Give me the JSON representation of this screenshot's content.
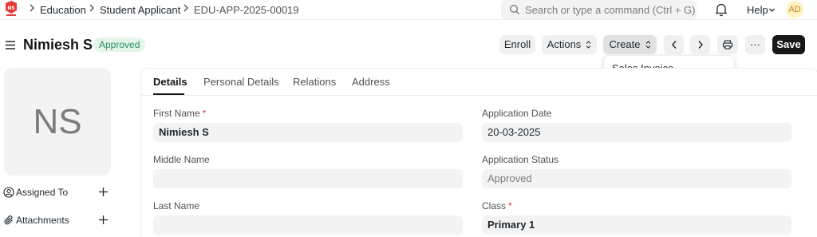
{
  "navbar": {
    "logo_name": "school-logo",
    "breadcrumbs": [
      "Education",
      "Student Applicant",
      "EDU-APP-2025-00019"
    ],
    "search_placeholder": "Search or type a command (Ctrl + G)",
    "help_label": "Help",
    "user_initials": "AD"
  },
  "header": {
    "title": "Nimiesh S",
    "status": "Approved",
    "buttons": {
      "enroll": "Enroll",
      "actions": "Actions",
      "create": "Create",
      "more": "···",
      "save": "Save"
    },
    "create_menu": [
      "Sales Invoice"
    ]
  },
  "sidebar": {
    "avatar_initials": "NS",
    "items": [
      {
        "label": "Assigned To",
        "icon": "user-circle-icon"
      },
      {
        "label": "Attachments",
        "icon": "paperclip-icon"
      }
    ]
  },
  "tabs": [
    "Details",
    "Personal Details",
    "Relations",
    "Address"
  ],
  "active_tab": "Details",
  "form": {
    "first_name": {
      "label": "First Name",
      "value": "Nimiesh S",
      "required": true
    },
    "middle_name": {
      "label": "Middle Name",
      "value": ""
    },
    "last_name": {
      "label": "Last Name",
      "value": ""
    },
    "application_date": {
      "label": "Application Date",
      "value": "20-03-2025"
    },
    "application_status": {
      "label": "Application Status",
      "value": "Approved"
    },
    "class": {
      "label": "Class",
      "value": "Primary 1",
      "required": true
    }
  },
  "colors": {
    "status_bg": "#e4f5e9",
    "status_text": "#278f5e",
    "save_bg": "#171717",
    "required_star": "#e03636"
  }
}
